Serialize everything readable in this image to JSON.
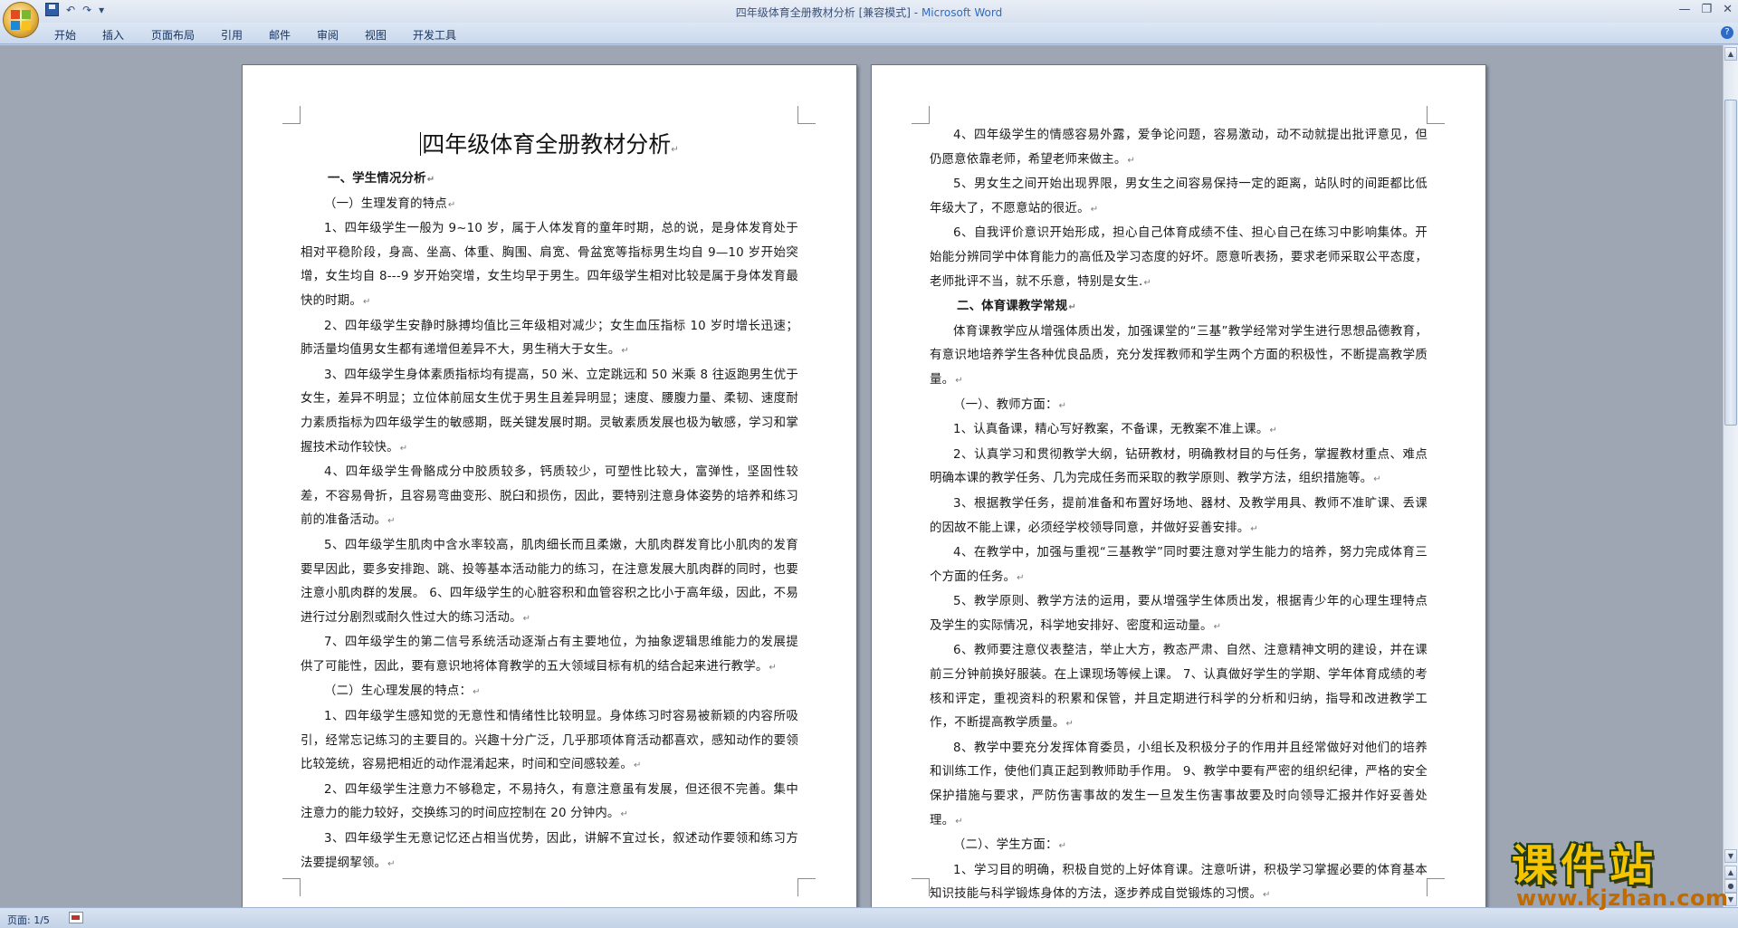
{
  "window": {
    "title": "四年级体育全册教材分析 [兼容模式]",
    "app_name": "Microsoft Word",
    "separator": " - "
  },
  "qat": {
    "dropdown": "▾"
  },
  "controls": {
    "minimize": "—",
    "restore": "❐",
    "close": "✕"
  },
  "ribbon": {
    "tabs": [
      "开始",
      "插入",
      "页面布局",
      "引用",
      "邮件",
      "审阅",
      "视图",
      "开发工具"
    ],
    "help": "?"
  },
  "status": {
    "page_count": "页面: 1/5"
  },
  "document": {
    "title": "四年级体育全册教材分析",
    "page1": [
      {
        "text": "一、学生情况分析",
        "heading": true
      },
      {
        "text": "（一）生理发育的特点"
      },
      {
        "text": "1、四年级学生一般为 9~10 岁，属于人体发育的童年时期，总的说，是身体发育处于相对平稳阶段，身高、坐高、体重、胸围、肩宽、骨盆宽等指标男生均自 9—10 岁开始突增，女生均自 8---9 岁开始突增，女生均早于男生。四年级学生相对比较是属于身体发育最快的时期。"
      },
      {
        "text": "2、四年级学生安静时脉搏均值比三年级相对减少；女生血压指标 10 岁时增长迅速；肺活量均值男女生都有递增但差异不大，男生稍大于女生。"
      },
      {
        "text": "3、四年级学生身体素质指标均有提高，50 米、立定跳远和 50 米乘 8 往返跑男生优于女生，差异不明显；立位体前屈女生优于男生且差异明显；速度、腰腹力量、柔韧、速度耐力素质指标为四年级学生的敏感期，既关键发展时期。灵敏素质发展也极为敏感，学习和掌握技术动作较快。"
      },
      {
        "text": "4、四年级学生骨骼成分中胶质较多，钙质较少，可塑性比较大，富弹性，坚固性较差，不容易骨折，且容易弯曲变形、脱臼和损伤，因此，要特别注意身体姿势的培养和练习前的准备活动。"
      },
      {
        "text": "5、四年级学生肌肉中含水率较高，肌肉细长而且柔嫩，大肌肉群发育比小肌肉的发育要早因此，要多安排跑、跳、投等基本活动能力的练习，在注意发展大肌肉群的同时，也要注意小肌肉群的发展。 6、四年级学生的心脏容积和血管容积之比小于高年级，因此，不易进行过分剧烈或耐久性过大的练习活动。"
      },
      {
        "text": "7、四年级学生的第二信号系统活动逐渐占有主要地位，为抽象逻辑思维能力的发展提供了可能性，因此，要有意识地将体育教学的五大领域目标有机的结合起来进行教学。"
      },
      {
        "text": "（二）生心理发展的特点："
      },
      {
        "text": "1、四年级学生感知觉的无意性和情绪性比较明显。身体练习时容易被新颖的内容所吸引，经常忘记练习的主要目的。兴趣十分广泛，几乎那项体育活动都喜欢，感知动作的要领比较笼统，容易把相近的动作混淆起来，时间和空间感较差。"
      },
      {
        "text": "2、四年级学生注意力不够稳定，不易持久，有意注意虽有发展，但还很不完善。集中注意力的能力较好，交换练习的时间应控制在 20 分钟内。"
      },
      {
        "text": "3、四年级学生无意记忆还占相当优势，因此，讲解不宜过长，叙述动作要领和练习方法要提纲挈领。"
      }
    ],
    "page2": [
      {
        "text": "4、四年级学生的情感容易外露，爱争论问题，容易激动，动不动就提出批评意见，但仍愿意依靠老师，希望老师来做主。"
      },
      {
        "text": "5、男女生之间开始出现界限，男女生之间容易保持一定的距离，站队时的间距都比低年级大了，不愿意站的很近。"
      },
      {
        "text": "6、自我评价意识开始形成，担心自己体育成绩不佳、担心自己在练习中影响集体。开始能分辨同学中体育能力的高低及学习态度的好坏。愿意听表扬，要求老师采取公平态度，老师批评不当，就不乐意，特别是女生."
      },
      {
        "text": "二、体育课教学常规",
        "heading": true
      },
      {
        "text": "体育课教学应从增强体质出发，加强课堂的“三基”教学经常对学生进行思想品德教育，有意识地培养学生各种优良品质，充分发挥教师和学生两个方面的积极性，不断提高教学质量。"
      },
      {
        "text": "（一）、教师方面："
      },
      {
        "text": "1、认真备课，精心写好教案，不备课，无教案不准上课。"
      },
      {
        "text": "2、认真学习和贯彻教学大纲，钻研教材，明确教材目的与任务，掌握教材重点、难点明确本课的教学任务、几为完成任务而采取的教学原则、教学方法，组织措施等。"
      },
      {
        "text": "3、根据教学任务，提前准备和布置好场地、器材、及教学用具、教师不准旷课、丢课的因故不能上课，必须经学校领导同意，并做好妥善安排。"
      },
      {
        "text": "4、在教学中，加强与重视“三基教学”同时要注意对学生能力的培养，努力完成体育三个方面的任务。"
      },
      {
        "text": "5、教学原则、教学方法的运用，要从增强学生体质出发，根据青少年的心理生理特点及学生的实际情况，科学地安排好、密度和运动量。"
      },
      {
        "text": "6、教师要注意仪表整洁，举止大方，教态严肃、自然、注意精神文明的建设，并在课前三分钟前换好服装。在上课现场等候上课。 7、认真做好学生的学期、学年体育成绩的考核和评定，重视资料的积累和保管，并且定期进行科学的分析和归纳，指导和改进教学工作，不断提高教学质量。"
      },
      {
        "text": "8、教学中要充分发挥体育委员，小组长及积极分子的作用并且经常做好对他们的培养和训练工作，使他们真正起到教师助手作用。 9、教学中要有严密的组织纪律，严格的安全保护措施与要求，严防伤害事故的发生一旦发生伤害事故要及时向领导汇报并作好妥善处理。"
      },
      {
        "text": "（二）、学生方面："
      },
      {
        "text": "1、学习目的明确，积极自觉的上好体育课。注意听讲，积极学习掌握必要的体育基本知识技能与科学锻炼身体的方法，逐步养成自觉锻炼的习惯。"
      }
    ]
  },
  "watermark": {
    "logo": "课件站",
    "url": "www.kjzhan.com"
  }
}
